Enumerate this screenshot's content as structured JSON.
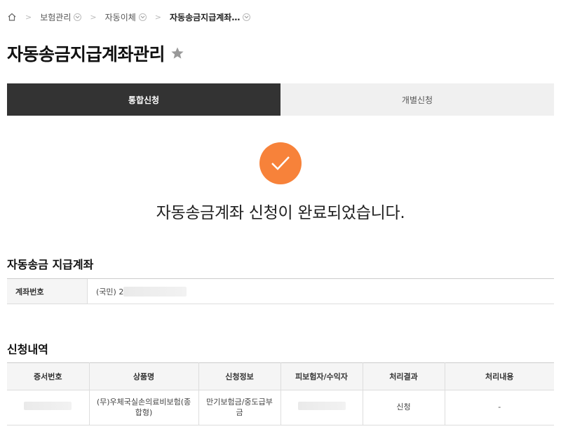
{
  "breadcrumb": {
    "items": [
      {
        "label": "보험관리"
      },
      {
        "label": "자동이체"
      },
      {
        "label": "자동송금지급계좌…"
      }
    ]
  },
  "page": {
    "title": "자동송금지급계좌관리"
  },
  "tabs": [
    {
      "label": "통합신청",
      "active": true
    },
    {
      "label": "개별신청",
      "active": false
    }
  ],
  "complete": {
    "message": "자동송금계좌 신청이 완료되었습니다.",
    "accent_color": "#f7823a"
  },
  "account_section": {
    "title": "자동송금 지급계좌",
    "row_header": "계좌번호",
    "value_prefix": "(국민) 2"
  },
  "request_section": {
    "title": "신청내역",
    "columns": [
      "증서번호",
      "상품명",
      "신청정보",
      "피보험자/수익자",
      "처리결과",
      "처리내용"
    ],
    "rows": [
      {
        "product": "(무)우체국실손의료비보험(종합형)",
        "request_info": "만기보험금/중도급부금",
        "result": "신청",
        "detail": "-"
      }
    ]
  }
}
